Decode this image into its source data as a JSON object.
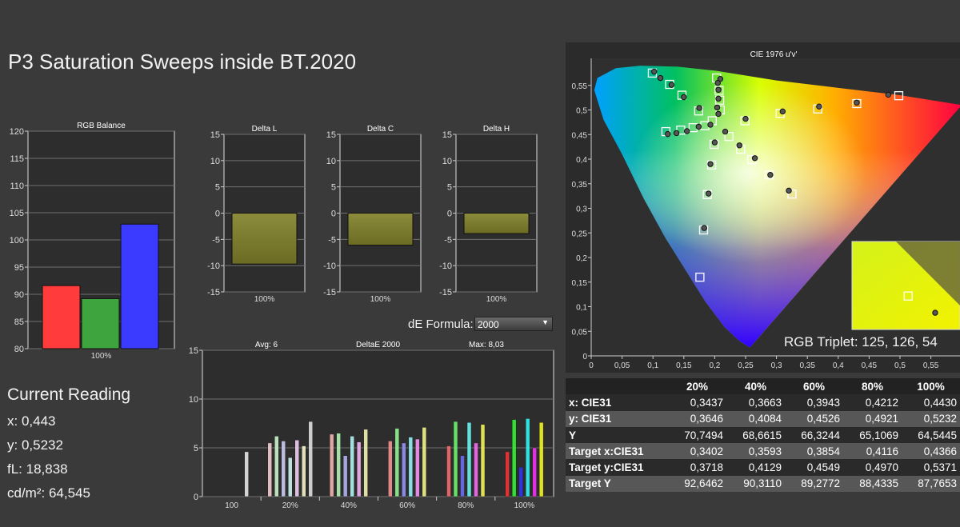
{
  "page_title": "P3 Saturation Sweeps inside BT.2020",
  "current_reading": {
    "title": "Current Reading",
    "x": "x: 0,443",
    "y": "y: 0,5232",
    "fl": "fL: 18,838",
    "cd": "cd/m²: 64,545"
  },
  "formula": {
    "label": "dE Formula:",
    "value": "2000"
  },
  "rgb_triplet": "RGB Triplet: 125, 126, 54",
  "chart_data": [
    {
      "type": "bar",
      "title": "RGB Balance",
      "categories": [
        "100%"
      ],
      "series": [
        {
          "values": [
            91.6
          ],
          "color": "#ff3b3b"
        },
        {
          "values": [
            89.2
          ],
          "color": "#3ea53e"
        },
        {
          "values": [
            102.9
          ],
          "color": "#3b3bff"
        }
      ],
      "ylim": [
        80,
        120
      ],
      "yticks": [
        "80",
        "85",
        "90",
        "95",
        "100",
        "105",
        "110",
        "115",
        "120"
      ],
      "grid": true
    },
    {
      "type": "bar",
      "title": "Delta L",
      "categories": [
        "100%"
      ],
      "values": [
        -9.7
      ],
      "ylim": [
        -15,
        15
      ],
      "yticks": [
        "-15",
        "-10",
        "-5",
        "0",
        "5",
        "10",
        "15"
      ],
      "grid": true
    },
    {
      "type": "bar",
      "title": "Delta C",
      "categories": [
        "100%"
      ],
      "values": [
        -6.1
      ],
      "ylim": [
        -15,
        15
      ],
      "yticks": [
        "-15",
        "-10",
        "-5",
        "0",
        "5",
        "10",
        "15"
      ],
      "grid": true
    },
    {
      "type": "bar",
      "title": "Delta H",
      "categories": [
        "100%"
      ],
      "values": [
        -3.9
      ],
      "ylim": [
        -15,
        15
      ],
      "yticks": [
        "-15",
        "-10",
        "-5",
        "0",
        "5",
        "10",
        "15"
      ],
      "grid": true
    },
    {
      "type": "bar",
      "title": "DeltaE 2000",
      "avg_label": "Avg: 6",
      "max_label": "Max: 8,03",
      "categories": [
        "100",
        "20%",
        "40%",
        "60%",
        "80%",
        "100%"
      ],
      "groups": [
        {
          "values": [
            4.6
          ],
          "colors": [
            "#f0f0f0"
          ]
        },
        {
          "values": [
            5.5,
            6.2,
            5.7,
            4.0,
            5.8,
            5.2,
            7.7
          ],
          "colors": [
            "#ffd7d7",
            "#d6ffd6",
            "#d6d6ff",
            "#d8ffff",
            "#ffd7ff",
            "#ffffd2",
            "#eaeaea"
          ]
        },
        {
          "values": [
            6.4,
            6.5,
            4.2,
            6.2,
            5.6,
            6.9
          ],
          "colors": [
            "#ffbcbc",
            "#bcffbc",
            "#bcbcff",
            "#bcffff",
            "#ffbcff",
            "#ffffb8"
          ]
        },
        {
          "values": [
            5.7,
            7.0,
            5.5,
            6.1,
            5.9,
            7.1
          ],
          "colors": [
            "#ff9a9a",
            "#9aff9a",
            "#9a9aff",
            "#9affff",
            "#ff9aff",
            "#ffff92"
          ]
        },
        {
          "values": [
            5.2,
            7.7,
            4.2,
            7.6,
            5.5,
            7.4
          ],
          "colors": [
            "#ff7070",
            "#70ff70",
            "#7070ff",
            "#70ffff",
            "#ff70ff",
            "#ffff5c"
          ]
        },
        {
          "values": [
            4.6,
            7.9,
            3.0,
            8.0,
            5.0,
            7.6
          ],
          "colors": [
            "#ff3333",
            "#33ff33",
            "#3333ff",
            "#33ffff",
            "#ff33ff",
            "#ffff22"
          ]
        }
      ],
      "ylim": [
        0,
        15
      ],
      "yticks": [
        "0",
        "5",
        "10",
        "15"
      ],
      "grid": true
    },
    {
      "type": "scatter",
      "title": "CIE 1976 u'v'",
      "xlim": [
        0,
        0.6
      ],
      "ylim": [
        0,
        0.6
      ],
      "xticks": [
        "0",
        "0,05",
        "0,1",
        "0,15",
        "0,2",
        "0,25",
        "0,3",
        "0,35",
        "0,4",
        "0,45",
        "0,5",
        "0,55"
      ],
      "yticks": [
        "0",
        "0,05",
        "0,1",
        "0,15",
        "0,2",
        "0,25",
        "0,3",
        "0,35",
        "0,4",
        "0,45",
        "0,5",
        "0,55"
      ],
      "targets": [
        [
          0.099,
          0.575
        ],
        [
          0.127,
          0.552
        ],
        [
          0.147,
          0.53
        ],
        [
          0.174,
          0.498
        ],
        [
          0.196,
          0.478
        ],
        [
          0.203,
          0.565
        ],
        [
          0.207,
          0.54
        ],
        [
          0.208,
          0.52
        ],
        [
          0.209,
          0.5
        ],
        [
          0.121,
          0.456
        ],
        [
          0.145,
          0.459
        ],
        [
          0.165,
          0.464
        ],
        [
          0.184,
          0.468
        ],
        [
          0.249,
          0.478
        ],
        [
          0.306,
          0.493
        ],
        [
          0.367,
          0.502
        ],
        [
          0.43,
          0.513
        ],
        [
          0.498,
          0.529
        ],
        [
          0.223,
          0.446
        ],
        [
          0.242,
          0.42
        ],
        [
          0.26,
          0.399
        ],
        [
          0.288,
          0.368
        ],
        [
          0.325,
          0.329
        ],
        [
          0.199,
          0.43
        ],
        [
          0.195,
          0.388
        ],
        [
          0.188,
          0.328
        ],
        [
          0.182,
          0.256
        ],
        [
          0.176,
          0.16
        ]
      ],
      "measured": [
        [
          0.102,
          0.578
        ],
        [
          0.112,
          0.565
        ],
        [
          0.13,
          0.551
        ],
        [
          0.15,
          0.526
        ],
        [
          0.175,
          0.504
        ],
        [
          0.209,
          0.563
        ],
        [
          0.205,
          0.555
        ],
        [
          0.206,
          0.541
        ],
        [
          0.206,
          0.523
        ],
        [
          0.204,
          0.505
        ],
        [
          0.206,
          0.492
        ],
        [
          0.124,
          0.451
        ],
        [
          0.138,
          0.453
        ],
        [
          0.155,
          0.457
        ],
        [
          0.174,
          0.466
        ],
        [
          0.193,
          0.47
        ],
        [
          0.25,
          0.482
        ],
        [
          0.31,
          0.497
        ],
        [
          0.369,
          0.507
        ],
        [
          0.43,
          0.515
        ],
        [
          0.481,
          0.531
        ],
        [
          0.217,
          0.456
        ],
        [
          0.24,
          0.428
        ],
        [
          0.265,
          0.402
        ],
        [
          0.29,
          0.368
        ],
        [
          0.32,
          0.336
        ],
        [
          0.2,
          0.434
        ],
        [
          0.193,
          0.39
        ],
        [
          0.19,
          0.33
        ],
        [
          0.183,
          0.26
        ]
      ],
      "inset": {
        "target": [
          0.52,
          0.38
        ],
        "measured": [
          0.77,
          0.19
        ]
      }
    }
  ],
  "table": {
    "header": [
      "",
      "20%",
      "40%",
      "60%",
      "80%",
      "100%"
    ],
    "rows": [
      {
        "label": "x: CIE31",
        "values": [
          "0,3437",
          "0,3663",
          "0,3943",
          "0,4212",
          "0,4430"
        ]
      },
      {
        "label": "y: CIE31",
        "values": [
          "0,3646",
          "0,4084",
          "0,4526",
          "0,4921",
          "0,5232"
        ]
      },
      {
        "label": "Y",
        "values": [
          "70,7494",
          "68,6615",
          "66,3244",
          "65,1069",
          "64,5445"
        ]
      },
      {
        "label": "Target x:CIE31",
        "values": [
          "0,3402",
          "0,3593",
          "0,3854",
          "0,4116",
          "0,4366"
        ]
      },
      {
        "label": "Target y:CIE31",
        "values": [
          "0,3718",
          "0,4129",
          "0,4549",
          "0,4970",
          "0,5371"
        ]
      },
      {
        "label": "Target Y",
        "values": [
          "92,6462",
          "90,3110",
          "89,2772",
          "88,4335",
          "87,7653"
        ]
      }
    ]
  }
}
